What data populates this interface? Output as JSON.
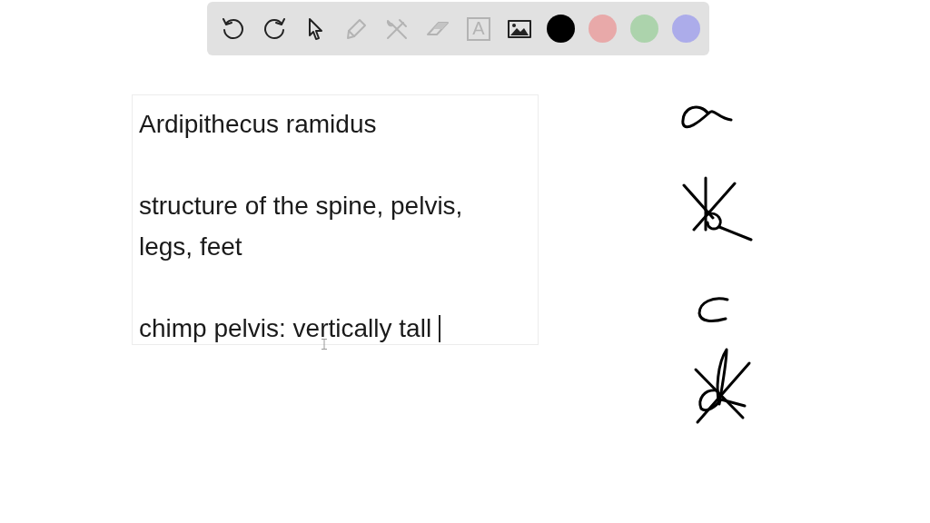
{
  "toolbar": {
    "tools": [
      {
        "kind": "undo",
        "disabled": false
      },
      {
        "kind": "redo",
        "disabled": false
      },
      {
        "kind": "pointer",
        "disabled": false
      },
      {
        "kind": "pencil",
        "disabled": true
      },
      {
        "kind": "tools",
        "disabled": true
      },
      {
        "kind": "eraser",
        "disabled": true
      },
      {
        "kind": "text",
        "glyph": "A",
        "disabled": true
      },
      {
        "kind": "image",
        "disabled": false
      }
    ],
    "colors": [
      {
        "color": "#000000"
      },
      {
        "color": "#e8a9a9"
      },
      {
        "color": "#acd3ac"
      },
      {
        "color": "#acacea"
      }
    ]
  },
  "text_box": {
    "paragraphs": [
      {
        "lines": [
          "Ardipithecus ramidus"
        ]
      },
      {
        "lines": [
          "structure of the spine, pelvis,",
          "legs, feet"
        ]
      },
      {
        "lines": [
          "chimp pelvis: vertically tall"
        ]
      }
    ],
    "caret": true
  }
}
